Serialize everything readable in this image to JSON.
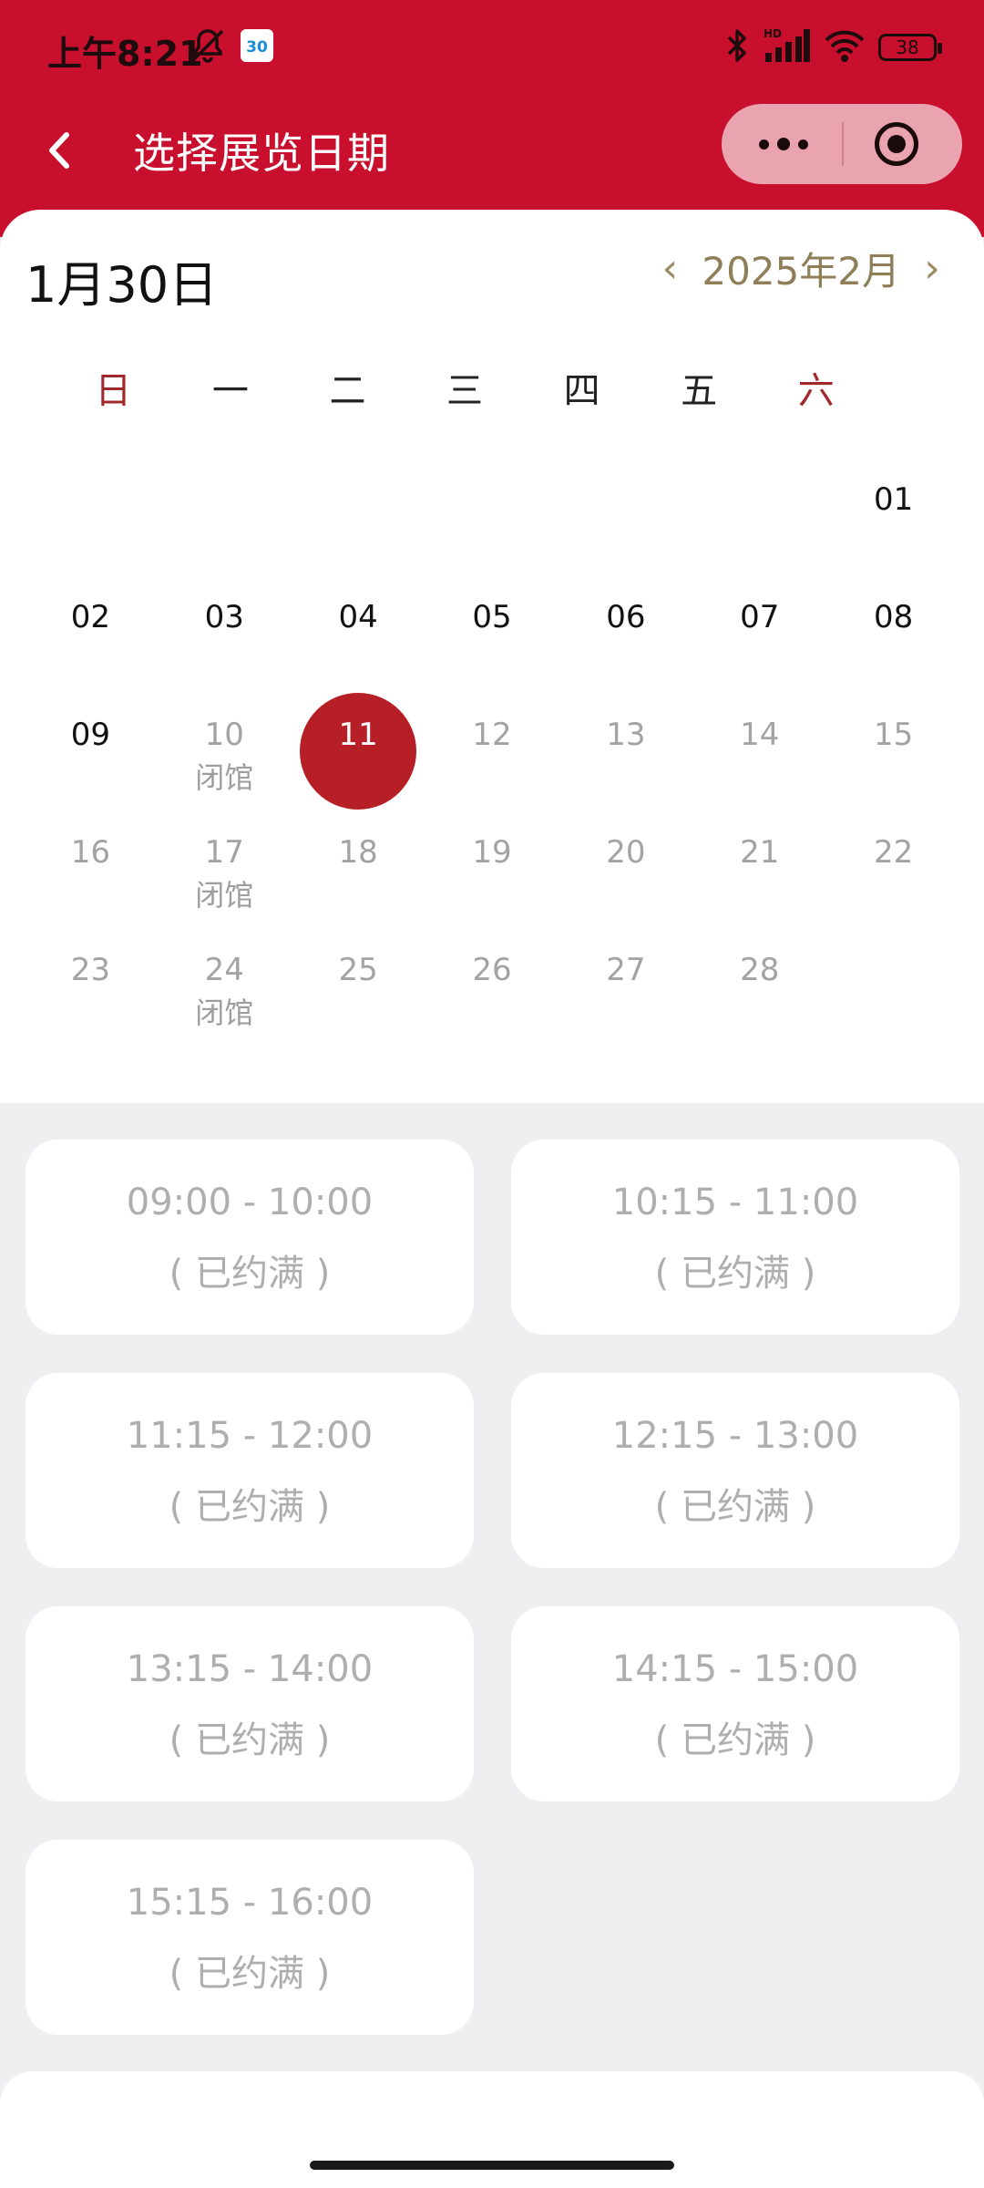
{
  "status_bar": {
    "time": "上午8:21",
    "calendar_badge": "30",
    "battery": "38"
  },
  "nav": {
    "title": "选择展览日期"
  },
  "calendar": {
    "selected_date": "1月30日",
    "month_label": "2025年2月",
    "weekdays": [
      "日",
      "一",
      "二",
      "三",
      "四",
      "五",
      "六"
    ],
    "weeks": [
      [
        {
          "day": ""
        },
        {
          "day": ""
        },
        {
          "day": ""
        },
        {
          "day": ""
        },
        {
          "day": ""
        },
        {
          "day": ""
        },
        {
          "day": "01"
        }
      ],
      [
        {
          "day": "02"
        },
        {
          "day": "03"
        },
        {
          "day": "04"
        },
        {
          "day": "05"
        },
        {
          "day": "06"
        },
        {
          "day": "07"
        },
        {
          "day": "08"
        }
      ],
      [
        {
          "day": "09"
        },
        {
          "day": "10",
          "note": "闭馆"
        },
        {
          "day": "11"
        },
        {
          "day": "12"
        },
        {
          "day": "13"
        },
        {
          "day": "14"
        },
        {
          "day": "15"
        }
      ],
      [
        {
          "day": "16"
        },
        {
          "day": "17",
          "note": "闭馆"
        },
        {
          "day": "18"
        },
        {
          "day": "19"
        },
        {
          "day": "20"
        },
        {
          "day": "21"
        },
        {
          "day": "22"
        }
      ],
      [
        {
          "day": "23"
        },
        {
          "day": "24",
          "note": "闭馆"
        },
        {
          "day": "25"
        },
        {
          "day": "26"
        },
        {
          "day": "27"
        },
        {
          "day": "28"
        },
        {
          "day": ""
        }
      ]
    ],
    "selected_day": "11",
    "colors": {
      "weekend_header": "#a1292c",
      "selected_circle": "#b61f26",
      "dim_text": "#a3a3a3",
      "month_nav": "#9a8a64"
    }
  },
  "time_slots": [
    {
      "time": "09:00 - 10:00",
      "status": "( 已约满 )"
    },
    {
      "time": "10:15 - 11:00",
      "status": "( 已约满 )"
    },
    {
      "time": "11:15 - 12:00",
      "status": "( 已约满 )"
    },
    {
      "time": "12:15 - 13:00",
      "status": "( 已约满 )"
    },
    {
      "time": "13:15 - 14:00",
      "status": "( 已约满 )"
    },
    {
      "time": "14:15 - 15:00",
      "status": "( 已约满 )"
    },
    {
      "time": "15:15 - 16:00",
      "status": "( 已约满 )"
    }
  ],
  "theme": {
    "header_red": "#c8102e",
    "page_bg": "#efeff1"
  },
  "icons": [
    "mute-bell-icon",
    "bluetooth-icon",
    "signal-icon",
    "wifi-icon",
    "battery-icon",
    "back-chevron-icon",
    "more-dots-icon",
    "close-target-icon"
  ]
}
